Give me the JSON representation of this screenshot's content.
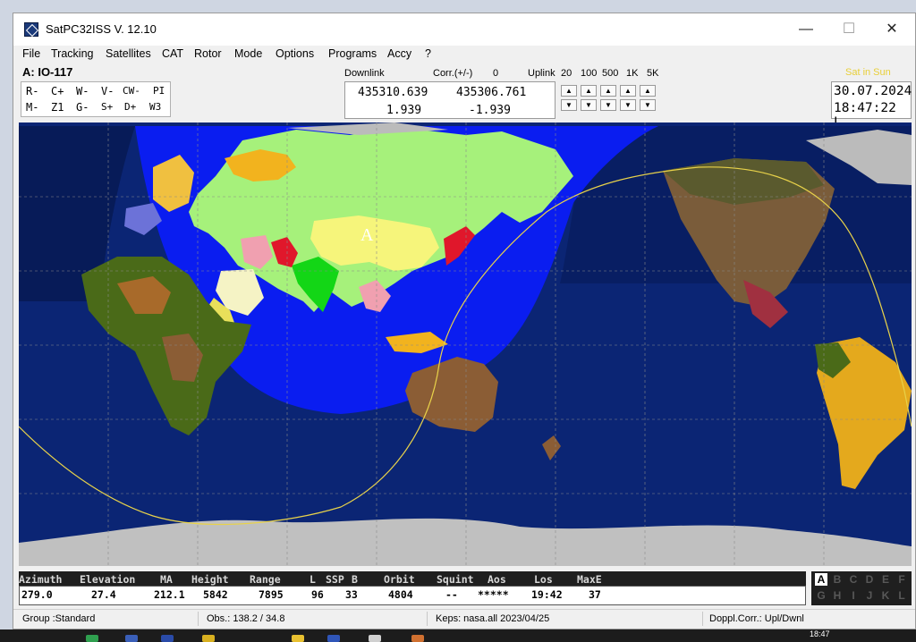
{
  "window": {
    "title": "SatPC32ISS V. 12.10",
    "controls": {
      "minimize": "—",
      "maximize": "☐",
      "close": "✕"
    }
  },
  "menu": [
    "File",
    "Tracking",
    "Satellites",
    "CAT",
    "Rotor",
    "Mode",
    "Options",
    "Programs",
    "Accy",
    "?"
  ],
  "satellite": {
    "label": "A: IO-117"
  },
  "commands": {
    "row1": [
      "R-",
      "C+",
      "W-",
      "V-",
      "CW-",
      "PI"
    ],
    "row2": [
      "M-",
      "Z1",
      "G-",
      "S+",
      "D+",
      "W3"
    ]
  },
  "radio": {
    "downlink_label": "Downlink",
    "corr_label": "Corr.(+/-)",
    "corr_value": "0",
    "uplink_label": "Uplink",
    "steps": [
      "20",
      "100",
      "500",
      "1K",
      "5K"
    ],
    "downlink_freq": "435310.639",
    "uplink_freq": "435306.761",
    "downlink_doppler": "1.939",
    "uplink_doppler": "-1.939"
  },
  "sun_status": "Sat in Sun",
  "datetime": {
    "date": "30.07.2024",
    "time": "18:47:22 L"
  },
  "map": {
    "satellite_marker": "A"
  },
  "data_table": {
    "headers": [
      "Azimuth",
      "Elevation",
      "MA",
      "Height",
      "Range",
      "L",
      "SSP",
      "B",
      "Orbit",
      "Squint",
      "Aos",
      "Los",
      "MaxE"
    ],
    "values": [
      "279.0",
      "27.4",
      "212.1",
      "5842",
      "7895",
      "96",
      "33",
      "4804",
      "--",
      "*****",
      "19:42",
      "37"
    ]
  },
  "letters": {
    "row1": [
      "A",
      "B",
      "C",
      "D",
      "E",
      "F"
    ],
    "row2": [
      "G",
      "H",
      "I",
      "J",
      "K",
      "L"
    ],
    "active": "A"
  },
  "status": {
    "group": "Group :Standard",
    "obs": "Obs.: 138.2 / 34.8",
    "keps": "Keps: nasa.all 2023/04/25",
    "doppl": "Doppl.Corr.: Upl/Dwnl"
  },
  "taskbar": {
    "time": "18:47"
  },
  "colors": {
    "ocean": "#0b2574",
    "footprint": "#0a1df0",
    "night_band": "#071b58",
    "track": "#e8d24a",
    "ice": "#c0c0c0"
  }
}
